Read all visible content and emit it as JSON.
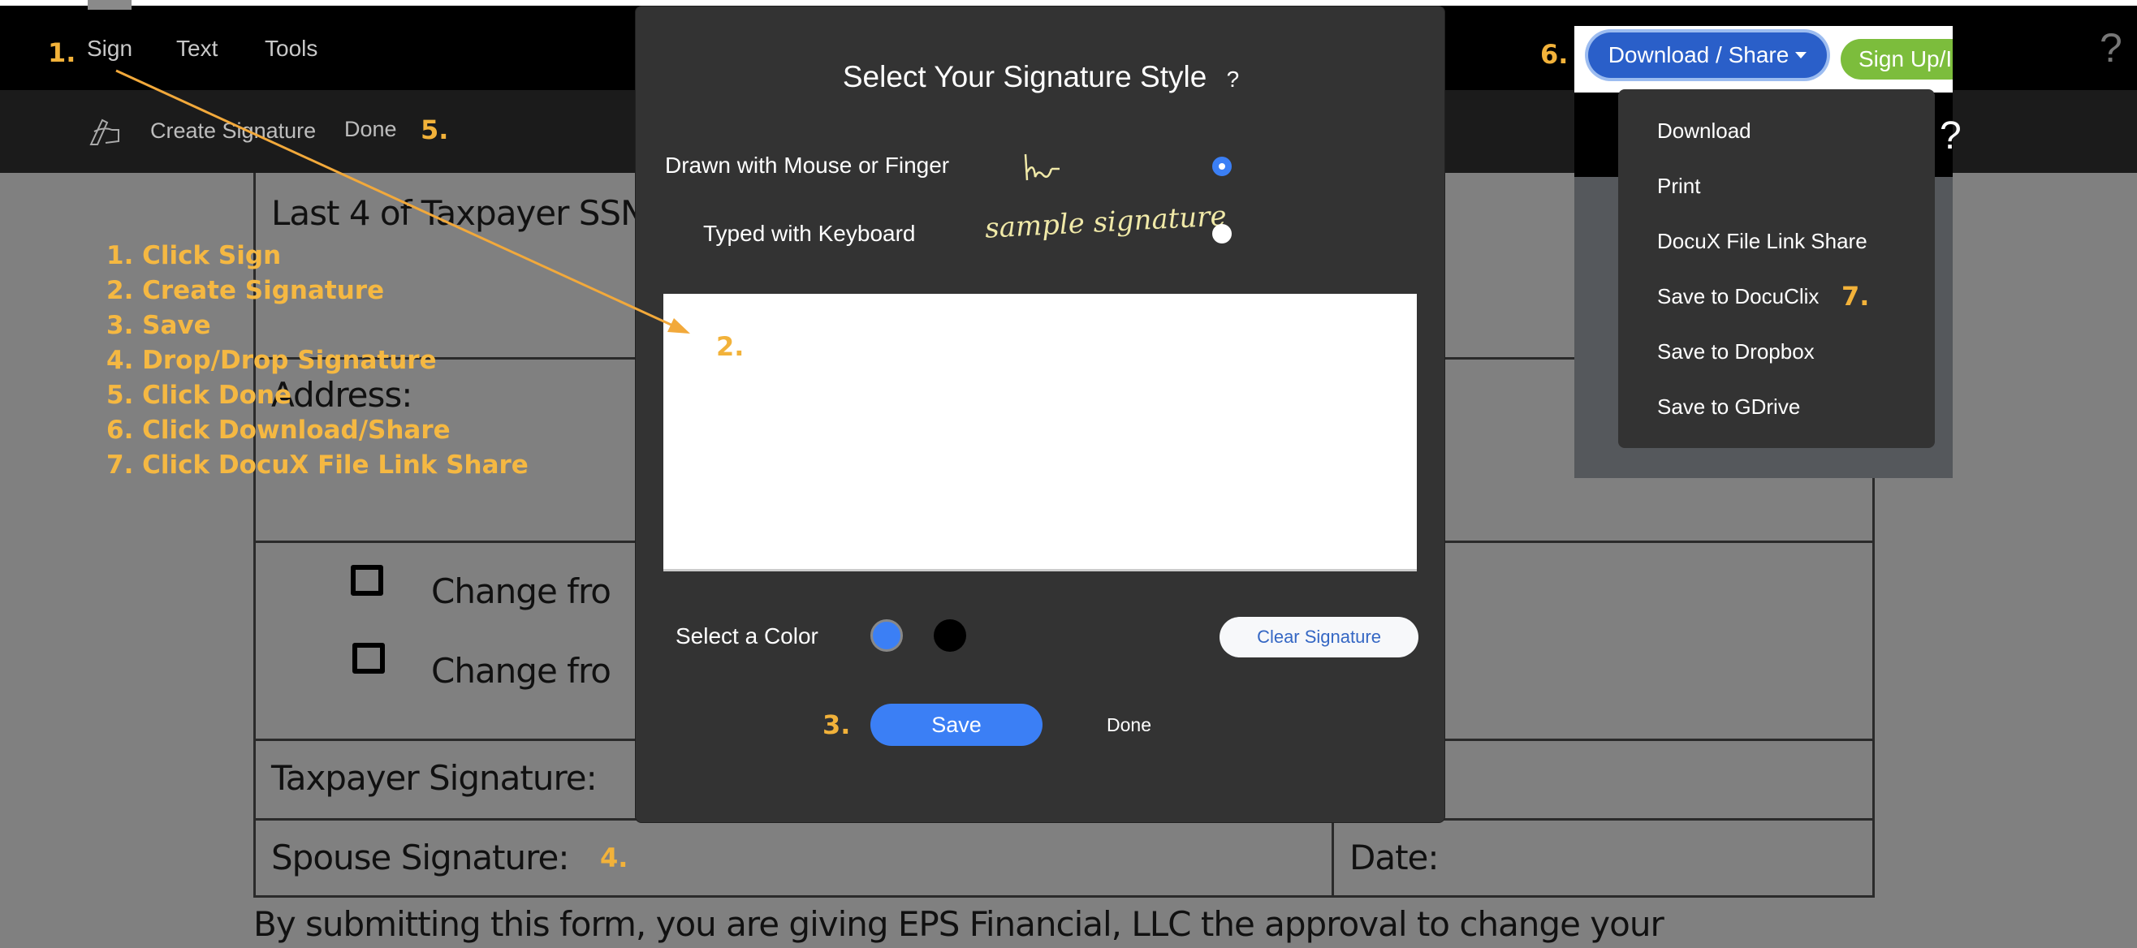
{
  "menu": {
    "items": [
      "Sign",
      "Text",
      "Tools"
    ]
  },
  "toolbar": {
    "icon": "signature-hand-icon",
    "create_signature": "Create Signature",
    "done": "Done"
  },
  "document": {
    "ssn_label": "Last 4 of Taxpayer SSN",
    "address_label": "Address:",
    "change_1": "Change fro",
    "change_2": "Change fro",
    "taxpayer_signature": "Taxpayer Signature:",
    "spouse_signature": "Spouse Signature:",
    "date_label": "Date:",
    "footer_text": "By submitting this form, you are giving EPS Financial, LLC the approval to change your"
  },
  "instructions": [
    "1. Click Sign",
    "2. Create Signature",
    "3. Save",
    "4. Drop/Drop Signature",
    "5. Click Done",
    "6. Click Download/Share",
    "7. Click DocuX File Link Share"
  ],
  "steps": {
    "s1": "1.",
    "s2": "2.",
    "s3": "3.",
    "s4": "4.",
    "s5": "5.",
    "s6": "6.",
    "s7": "7."
  },
  "modal": {
    "title": "Select Your Signature Style",
    "help": "?",
    "option_drawn": "Drawn with Mouse or Finger",
    "option_typed": "Typed with Keyboard",
    "typed_sample": "sample signature",
    "selected_option": "drawn",
    "color_label": "Select a Color",
    "colors": [
      "#3b7ff5",
      "#000000"
    ],
    "selected_color": "#3b7ff5",
    "clear_button": "Clear Signature",
    "save_button": "Save",
    "done_button": "Done"
  },
  "header_right": {
    "download_share": "Download / Share",
    "signup": "Sign Up/I",
    "help": "?",
    "help2": "?",
    "colors": {
      "download": "#2a5fc9",
      "signup": "#7cbd3c"
    }
  },
  "dropdown": {
    "items": [
      "Download",
      "Print",
      "DocuX File Link Share",
      "Save to DocuClix",
      "Save to Dropbox",
      "Save to GDrive"
    ]
  }
}
